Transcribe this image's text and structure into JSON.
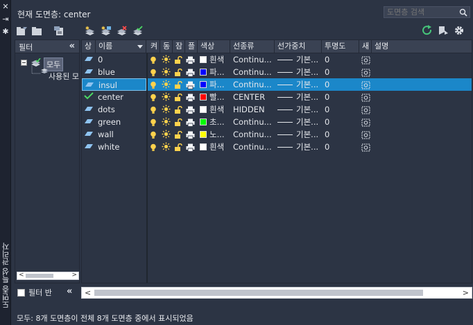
{
  "window": {
    "vertical_title": "도면층 특성 관리자",
    "close_glyph": "✕",
    "autohide_glyph": "⇥",
    "settings_glyph": "✱"
  },
  "header": {
    "current_layer": "현재 도면층: center",
    "search_placeholder": "도면층 검색"
  },
  "filters": {
    "title": "필터",
    "collapse": "«",
    "all": "모두",
    "used": "사용된 모든 도면층",
    "invert_label": "필터 반",
    "collapse2": "«"
  },
  "columns": {
    "status": "상",
    "name": "이름",
    "on": "켜",
    "freeze": "동",
    "lock": "잠",
    "plot": "플",
    "color": "색상",
    "linetype": "선종류",
    "lineweight": "선가중치",
    "transparency": "투명도",
    "newvp": "새",
    "description": "설명"
  },
  "layers": [
    {
      "name": "0",
      "color_name": "흰색",
      "color": "#ffffff",
      "linetype": "Continu...",
      "lineweight": "기본...",
      "transparency": "0",
      "current": false,
      "selected": false
    },
    {
      "name": "blue",
      "color_name": "파...",
      "color": "#0000ff",
      "linetype": "Continu...",
      "lineweight": "기본...",
      "transparency": "0",
      "current": false,
      "selected": false
    },
    {
      "name": "insul",
      "color_name": "파...",
      "color": "#0000ff",
      "linetype": "Continu...",
      "lineweight": "기본...",
      "transparency": "0",
      "current": false,
      "selected": true
    },
    {
      "name": "center",
      "color_name": "빨...",
      "color": "#ff0000",
      "linetype": "CENTER",
      "lineweight": "기본...",
      "transparency": "0",
      "current": true,
      "selected": false
    },
    {
      "name": "dots",
      "color_name": "흰색",
      "color": "#ffffff",
      "linetype": "HIDDEN",
      "lineweight": "기본...",
      "transparency": "0",
      "current": false,
      "selected": false
    },
    {
      "name": "green",
      "color_name": "초...",
      "color": "#00ff00",
      "linetype": "Continu...",
      "lineweight": "기본...",
      "transparency": "0",
      "current": false,
      "selected": false
    },
    {
      "name": "wall",
      "color_name": "노...",
      "color": "#ffff00",
      "linetype": "Continu...",
      "lineweight": "기본...",
      "transparency": "0",
      "current": false,
      "selected": false
    },
    {
      "name": "white",
      "color_name": "흰색",
      "color": "#ffffff",
      "linetype": "Continu...",
      "lineweight": "기본...",
      "transparency": "0",
      "current": false,
      "selected": false
    }
  ],
  "scroll": {
    "left": "<",
    "right": ">"
  },
  "status": "모두: 8개 도면층이 전체 8개 도면층 중에서 표시되었음",
  "colors": {
    "accent": "#1b87c9",
    "panel": "#2c3444",
    "header": "#3a4253"
  }
}
